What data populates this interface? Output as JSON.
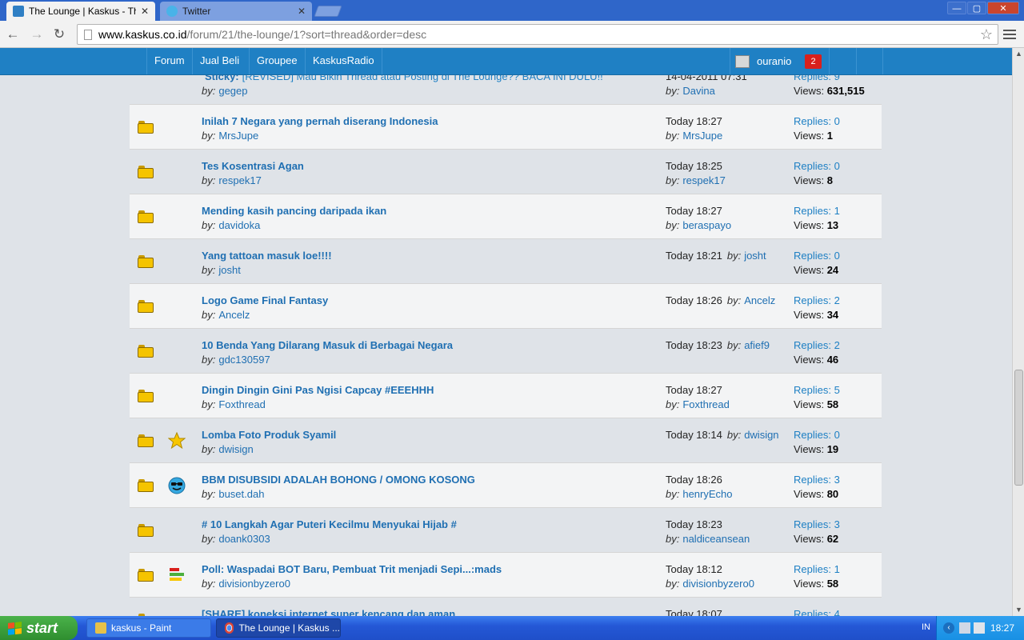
{
  "browser": {
    "tabs": [
      {
        "title": "The Lounge | Kaskus - The Lounge",
        "active": true
      },
      {
        "title": "Twitter",
        "active": false
      }
    ],
    "url_host": "www.kaskus.co.id",
    "url_path": "/forum/21/the-lounge/1?sort=thread&order=desc",
    "window_buttons": {
      "minimize": "—",
      "restore": "▢",
      "close": "✕"
    }
  },
  "sitenav": {
    "items": [
      "Forum",
      "Jual Beli",
      "Groupee",
      "KaskusRadio"
    ],
    "username": "ouranio",
    "notifications": "2"
  },
  "threads": [
    {
      "icon": "sticky",
      "sticky_label": "Sticky:",
      "title": "[REVISED] Mau Bikin Thread atau Posting di The Lounge?? BACA INI DULU!!",
      "by": "by:",
      "author": "gegep",
      "last_time": "14-04-2011 07:31",
      "last_by": "Davina",
      "inline": false,
      "replies_label": "Replies:",
      "replies": "9",
      "views_label": "Views:",
      "views": "631,515"
    },
    {
      "icon": "",
      "title": "Inilah 7 Negara yang pernah diserang Indonesia",
      "by": "by:",
      "author": "MrsJupe",
      "last_time": "Today 18:27",
      "last_by": "MrsJupe",
      "inline": false,
      "replies_label": "Replies:",
      "replies": "0",
      "views_label": "Views:",
      "views": "1"
    },
    {
      "icon": "",
      "title": "Tes Kosentrasi Agan",
      "by": "by:",
      "author": "respek17",
      "last_time": "Today 18:25",
      "last_by": "respek17",
      "inline": false,
      "replies_label": "Replies:",
      "replies": "0",
      "views_label": "Views:",
      "views": "8"
    },
    {
      "icon": "",
      "title": "Mending kasih pancing daripada ikan",
      "by": "by:",
      "author": "davidoka",
      "last_time": "Today 18:27",
      "last_by": "beraspayo",
      "inline": false,
      "replies_label": "Replies:",
      "replies": "1",
      "views_label": "Views:",
      "views": "13"
    },
    {
      "icon": "",
      "title": "Yang tattoan masuk loe!!!!",
      "by": "by:",
      "author": "josht",
      "last_time": "Today 18:21",
      "last_by": "josht",
      "inline": true,
      "replies_label": "Replies:",
      "replies": "0",
      "views_label": "Views:",
      "views": "24"
    },
    {
      "icon": "",
      "title": "Logo Game Final Fantasy",
      "by": "by:",
      "author": "Ancelz",
      "last_time": "Today 18:26",
      "last_by": "Ancelz",
      "inline": true,
      "replies_label": "Replies:",
      "replies": "2",
      "views_label": "Views:",
      "views": "34"
    },
    {
      "icon": "",
      "title": "10 Benda Yang Dilarang Masuk di Berbagai Negara",
      "by": "by:",
      "author": "gdc130597",
      "last_time": "Today 18:23",
      "last_by": "afief9",
      "inline": true,
      "replies_label": "Replies:",
      "replies": "2",
      "views_label": "Views:",
      "views": "46"
    },
    {
      "icon": "",
      "title": "Dingin Dingin Gini Pas Ngisi Capcay #EEEHHH",
      "by": "by:",
      "author": "Foxthread",
      "last_time": "Today 18:27",
      "last_by": "Foxthread",
      "inline": false,
      "replies_label": "Replies:",
      "replies": "5",
      "views_label": "Views:",
      "views": "58"
    },
    {
      "icon": "star",
      "title": "Lomba Foto Produk Syamil",
      "by": "by:",
      "author": "dwisign",
      "last_time": "Today 18:14",
      "last_by": "dwisign",
      "inline": true,
      "replies_label": "Replies:",
      "replies": "0",
      "views_label": "Views:",
      "views": "19"
    },
    {
      "icon": "cool",
      "title": "BBM DISUBSIDI ADALAH BOHONG / OMONG KOSONG",
      "by": "by:",
      "author": "buset.dah",
      "last_time": "Today 18:26",
      "last_by": "henryEcho",
      "inline": false,
      "replies_label": "Replies:",
      "replies": "3",
      "views_label": "Views:",
      "views": "80"
    },
    {
      "icon": "",
      "title": "# 10 Langkah Agar Puteri Kecilmu Menyukai Hijab #",
      "by": "by:",
      "author": "doank0303",
      "last_time": "Today 18:23",
      "last_by": "naldiceansean",
      "inline": false,
      "replies_label": "Replies:",
      "replies": "3",
      "views_label": "Views:",
      "views": "62"
    },
    {
      "icon": "poll",
      "title": "Poll: Waspadai BOT Baru, Pembuat Trit menjadi Sepi...:mads",
      "by": "by:",
      "author": "divisionbyzero0",
      "last_time": "Today 18:12",
      "last_by": "divisionbyzero0",
      "inline": false,
      "replies_label": "Replies:",
      "replies": "1",
      "views_label": "Views:",
      "views": "58"
    },
    {
      "icon": "",
      "title": "[SHARE] koneksi internet super kencang dan aman",
      "by": "by:",
      "author": "",
      "last_time": "Today 18:07",
      "last_by": "",
      "inline": false,
      "replies_label": "Replies:",
      "replies": "4",
      "views_label": "Views:",
      "views": ""
    }
  ],
  "taskbar": {
    "start": "start",
    "items": [
      "kaskus - Paint",
      "The Lounge | Kaskus ..."
    ],
    "lang": "IN",
    "clock": "18:27"
  }
}
